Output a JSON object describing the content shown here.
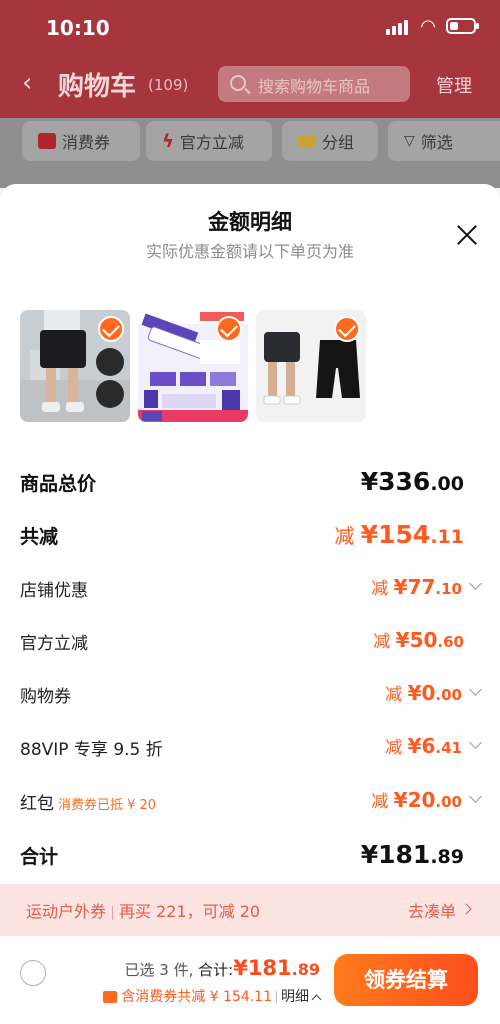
{
  "status_bar": {
    "time": "10:10"
  },
  "cart_header": {
    "back_icon": "chevron-left-icon",
    "title": "购物车",
    "count": "(109)",
    "search_placeholder": "搜索购物车商品",
    "manage_label": "管理"
  },
  "filter_chips": [
    {
      "label": "消费券",
      "icon": "coupon-icon",
      "color": "#b0252a"
    },
    {
      "label": "官方立减",
      "icon": "lightning-icon",
      "color": "#b0252a"
    },
    {
      "label": "分组",
      "icon": "folder-icon",
      "color": "#c9a23a"
    },
    {
      "label": "筛选",
      "icon": "funnel-icon",
      "color": "#3a3a3a"
    }
  ],
  "sheet": {
    "title": "金额明细",
    "subtitle": "实际优惠金额请以下单页为准",
    "products": [
      {
        "name": "shorts-on-model-image",
        "selected": true
      },
      {
        "name": "facial-cleanser-image",
        "selected": true
      },
      {
        "name": "black-shorts-image",
        "selected": true
      }
    ],
    "rows": {
      "total_goods": {
        "label": "商品总价",
        "prefix": "",
        "int": "¥336",
        "dec": ".00"
      },
      "total_reduce": {
        "label": "共减",
        "prefix": "减 ",
        "int": "¥154",
        "dec": ".11"
      },
      "store_discount": {
        "label": "店铺优惠",
        "prefix": "减 ",
        "int": "¥77",
        "dec": ".10"
      },
      "official_reduce": {
        "label": "官方立减",
        "prefix": "减 ",
        "int": "¥50",
        "dec": ".60"
      },
      "shopping_coupon": {
        "label": "购物券",
        "prefix": "减 ",
        "int": "¥0",
        "dec": ".00"
      },
      "vip_discount": {
        "label": "88VIP 专享 9.5 折",
        "prefix": "减 ",
        "int": "¥6",
        "dec": ".41"
      },
      "red_packet": {
        "label": "红包",
        "hint": "消费券已抵 ¥ 20",
        "prefix": "减 ",
        "int": "¥20",
        "dec": ".00"
      },
      "grand_total": {
        "label": "合计",
        "prefix": "",
        "int": "¥181",
        "dec": ".89"
      }
    }
  },
  "promo_bar": {
    "tag": "运动户外券",
    "text": "再买 221，可减 20",
    "action": "去凑单"
  },
  "footer": {
    "selected_text": "已选 3 件,",
    "total_label": "合计:",
    "total_int": "¥181",
    "total_dec": ".89",
    "coupon_text": "含消费券共减 ¥ 154.11",
    "detail_label": "明细",
    "checkout_label": "领券结算"
  },
  "colors": {
    "accent": "#ff5a1f",
    "header_bg": "#a7353d",
    "promo_bg": "#fbe4e2"
  }
}
